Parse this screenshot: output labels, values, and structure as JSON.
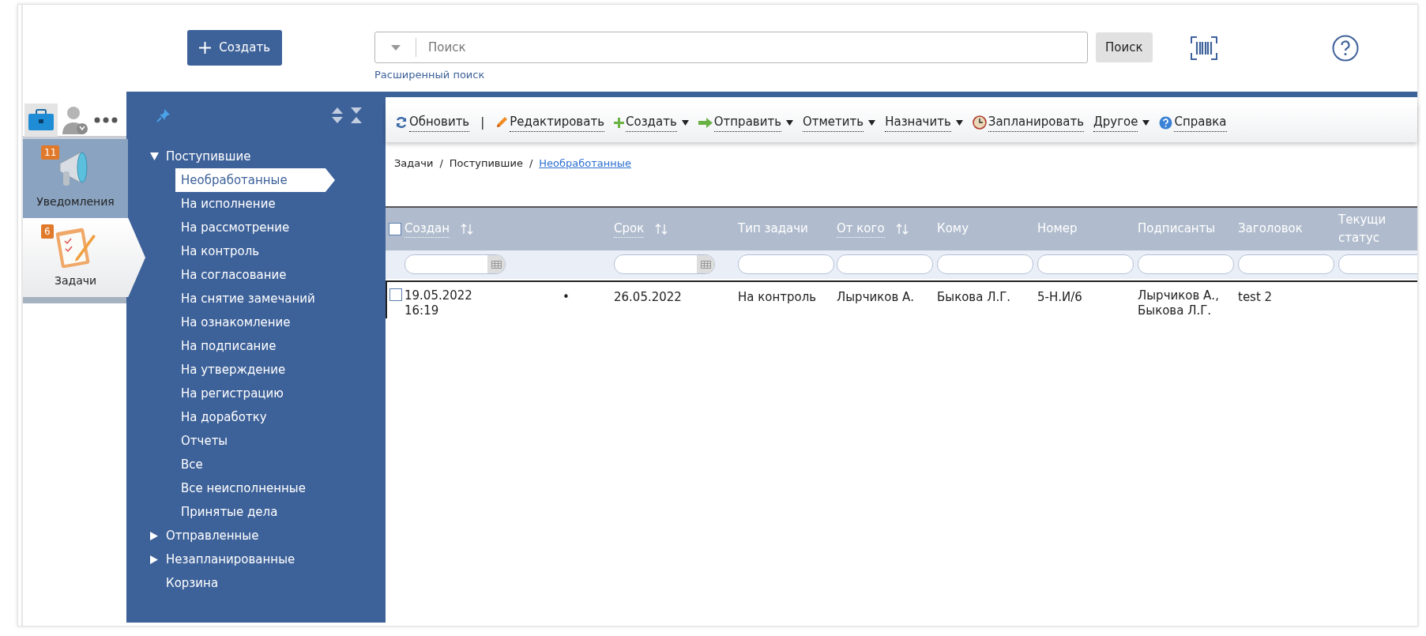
{
  "create_button": "Создать",
  "search": {
    "placeholder": "Поиск",
    "button": "Поиск",
    "advanced_link": "Расширенный поиск"
  },
  "modules": [
    {
      "kind": "notifications",
      "label": "Уведомления",
      "badge": "11",
      "selected": false
    },
    {
      "kind": "tasks",
      "label": "Задачи",
      "badge": "6",
      "selected": true
    }
  ],
  "tree": [
    {
      "label": "Поступившие",
      "expanded": true,
      "children": [
        {
          "label": "Необработанные",
          "selected": true
        },
        {
          "label": "На исполнение",
          "selected": false
        },
        {
          "label": "На рассмотрение",
          "selected": false
        },
        {
          "label": "На контроль",
          "selected": false
        },
        {
          "label": "На согласование",
          "selected": false
        },
        {
          "label": "На снятие замечаний",
          "selected": false
        },
        {
          "label": "На ознакомление",
          "selected": false
        },
        {
          "label": "На подписание",
          "selected": false
        },
        {
          "label": "На утверждение",
          "selected": false
        },
        {
          "label": "На регистрацию",
          "selected": false
        },
        {
          "label": "На доработку",
          "selected": false
        },
        {
          "label": "Отчеты",
          "selected": false
        },
        {
          "label": "Все",
          "selected": false
        },
        {
          "label": "Все неисполненные",
          "selected": false
        },
        {
          "label": "Принятые дела",
          "selected": false
        }
      ]
    },
    {
      "label": "Отправленные",
      "expanded": false
    },
    {
      "label": "Незапланированные",
      "expanded": false
    },
    {
      "label": "Корзина"
    }
  ],
  "toolbar": [
    {
      "kind": "refresh",
      "label": "Обновить",
      "dropdown": false
    },
    {
      "kind": "separator",
      "label": "|"
    },
    {
      "kind": "edit",
      "label": "Редактировать",
      "dropdown": false
    },
    {
      "kind": "create",
      "label": "Создать",
      "dropdown": true
    },
    {
      "kind": "send",
      "label": "Отправить",
      "dropdown": true
    },
    {
      "kind": "plain",
      "label": "Отметить",
      "dropdown": true
    },
    {
      "kind": "plain",
      "label": "Назначить",
      "dropdown": true
    },
    {
      "kind": "schedule",
      "label": "Запланировать",
      "dropdown": false
    },
    {
      "kind": "plain",
      "label": "Другое",
      "dropdown": true
    },
    {
      "kind": "help",
      "label": "Справка",
      "dropdown": false
    }
  ],
  "breadcrumbs": {
    "separator": "/",
    "items": [
      "Задачи",
      "Поступившие",
      "Необработанные"
    ]
  },
  "table": {
    "header_checked": false,
    "columns": [
      {
        "kind": "date",
        "label": "Создан",
        "sortable": true
      },
      {
        "kind": "none"
      },
      {
        "kind": "date",
        "label": "Срок",
        "sortable": true
      },
      {
        "kind": "text",
        "label": "Тип задачи",
        "sortable": false
      },
      {
        "kind": "text",
        "label": "От кого",
        "sortable": true
      },
      {
        "kind": "text",
        "label": "Кому",
        "sortable": false
      },
      {
        "kind": "text",
        "label": "Номер",
        "sortable": false
      },
      {
        "kind": "text",
        "label": "Подписанты",
        "sortable": false
      },
      {
        "kind": "text",
        "label": "Заголовок",
        "sortable": false
      },
      {
        "kind": "text",
        "label": "Текущи статус",
        "sortable": false
      }
    ],
    "rows": [
      {
        "selected": true,
        "checked": false,
        "cells": [
          "19.05.2022 16:19",
          "•",
          "26.05.2022",
          "На контроль",
          "Лырчиков А.",
          "Быкова Л.Г.",
          "5-Н.И/6",
          "Лырчиков А., Быкова Л.Г.",
          "test 2",
          ""
        ]
      }
    ]
  }
}
